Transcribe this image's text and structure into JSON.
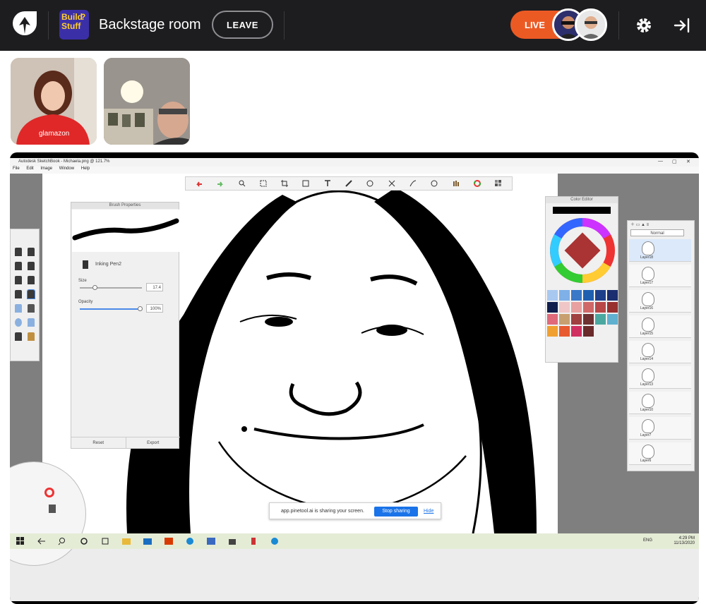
{
  "app": {
    "room_title": "Backstage room",
    "leave_label": "LEAVE",
    "live_label": "LIVE",
    "show_badge": [
      "Build",
      "Stuff",
      "?"
    ]
  },
  "colors": {
    "topbar": "#1d1d1f",
    "live": "#ec5a24",
    "accent_blue": "#1a73e8",
    "badge": "#3b2fa8"
  },
  "icons": [
    "pinetool-logo-icon",
    "settings-gear-icon",
    "exit-panel-icon"
  ],
  "participants": [
    {
      "name": "participant-1",
      "shirt_text": "glamazon"
    },
    {
      "name": "participant-2"
    }
  ],
  "screen_share": {
    "window_title": "Autodesk SketchBook - Michaela.png @ 121.7%",
    "menu": [
      "File",
      "Edit",
      "Image",
      "Window",
      "Help"
    ],
    "brush_panel": {
      "title": "Brush Properties",
      "brush_name": "Inking Pen2",
      "size_label": "Size",
      "size_value": "17.4",
      "opacity_label": "Opacity",
      "opacity_value": "100%",
      "reset_label": "Reset",
      "export_label": "Export",
      "size_level": 0.2,
      "opacity_level": 1.0
    },
    "color_panel": {
      "title": "Color Editor"
    },
    "layer_panel": {
      "blend_mode": "Normal",
      "layers": [
        "Layer18",
        "Layer17",
        "Layer16",
        "Layer15",
        "Layer14",
        "Layer13",
        "Layer10",
        "Layer7",
        "Layer6"
      ]
    },
    "swatches": [
      "#a8c8f0",
      "#7fb0e8",
      "#3a78c8",
      "#1f5fb0",
      "#1e3f8a",
      "#1a2d6e",
      "#0f1e4d",
      "#f0c6c6",
      "#e8a0a0",
      "#d06868",
      "#b84848",
      "#983030",
      "#e06a7a",
      "#c8a070",
      "#a04040",
      "#6e3030",
      "#4aa8a0",
      "#60b0d0",
      "#f0a030",
      "#e85a30",
      "#d03060",
      "#6a2a2a"
    ],
    "notification": {
      "text": "app.pinetool.ai is sharing your screen.",
      "stop_label": "Stop sharing",
      "hide_label": "Hide"
    },
    "taskbar": {
      "lang": "ENG",
      "time": "4:29 PM",
      "date": "11/13/2020"
    }
  }
}
